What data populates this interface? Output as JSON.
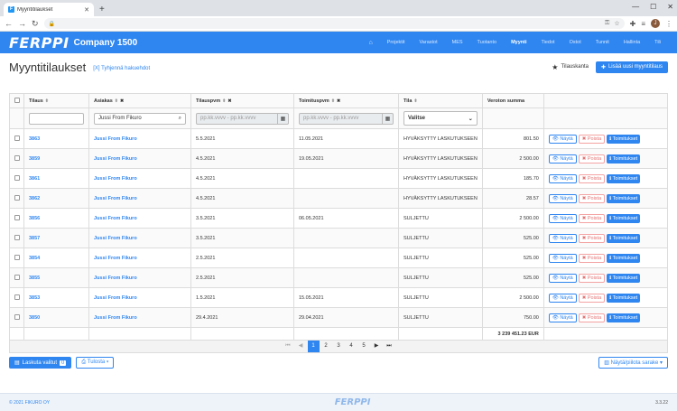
{
  "browser": {
    "tab_title": "Myyntitilaukset",
    "favicon": "F",
    "new_tab": "+",
    "profile_initial": "J"
  },
  "app": {
    "logo": "FERPPI",
    "company": "Company 1500",
    "nav": [
      "Projektit",
      "Varastot",
      "MES",
      "Tuotanto",
      "Myynti",
      "Tiedot",
      "Ostot",
      "Tunnit",
      "Hallinta",
      "Tili"
    ],
    "active_nav": "Myynti"
  },
  "page": {
    "title": "Myyntitilaukset",
    "clear_filters": "[X] Tyhjennä hakuehdot",
    "favorite_label": "Tilauskanta",
    "add_button": "Lisää uusi myyntitilaus"
  },
  "table": {
    "headers": [
      "Tilaus",
      "Asiakas",
      "Tilauspvm",
      "Toimituspvm",
      "Tila",
      "Veroton summa"
    ],
    "filters": {
      "customer": "Jussi From Fikuro",
      "date_placeholder": "pp.kk.vvvv - pp.kk.vvvv",
      "status_select": "Valitse"
    },
    "actions": {
      "view": "Näytä",
      "delete": "Poista",
      "deliveries": "Toimitukset"
    },
    "rows": [
      {
        "id": "3863",
        "customer": "Jussi From Fikuro",
        "order_date": "5.5.2021",
        "delivery_date": "11.05.2021",
        "status": "HYVÄKSYTTY LASKUTUKSEEN",
        "amount": "801.50"
      },
      {
        "id": "3859",
        "customer": "Jussi From Fikuro",
        "order_date": "4.5.2021",
        "delivery_date": "19.05.2021",
        "status": "HYVÄKSYTTY LASKUTUKSEEN",
        "amount": "2 500.00"
      },
      {
        "id": "3861",
        "customer": "Jussi From Fikuro",
        "order_date": "4.5.2021",
        "delivery_date": "",
        "status": "HYVÄKSYTTY LASKUTUKSEEN",
        "amount": "185.70"
      },
      {
        "id": "3862",
        "customer": "Jussi From Fikuro",
        "order_date": "4.5.2021",
        "delivery_date": "",
        "status": "HYVÄKSYTTY LASKUTUKSEEN",
        "amount": "28.57"
      },
      {
        "id": "3856",
        "customer": "Jussi From Fikuro",
        "order_date": "3.5.2021",
        "delivery_date": "06.05.2021",
        "status": "SULJETTU",
        "amount": "2 500.00"
      },
      {
        "id": "3857",
        "customer": "Jussi From Fikuro",
        "order_date": "3.5.2021",
        "delivery_date": "",
        "status": "SULJETTU",
        "amount": "525.00"
      },
      {
        "id": "3854",
        "customer": "Jussi From Fikuro",
        "order_date": "2.5.2021",
        "delivery_date": "",
        "status": "SULJETTU",
        "amount": "525.00"
      },
      {
        "id": "3855",
        "customer": "Jussi From Fikuro",
        "order_date": "2.5.2021",
        "delivery_date": "",
        "status": "SULJETTU",
        "amount": "525.00"
      },
      {
        "id": "3853",
        "customer": "Jussi From Fikuro",
        "order_date": "1.5.2021",
        "delivery_date": "15.05.2021",
        "status": "SULJETTU",
        "amount": "2 500.00"
      },
      {
        "id": "3850",
        "customer": "Jussi From Fikuro",
        "order_date": "29.4.2021",
        "delivery_date": "29.04.2021",
        "status": "SULJETTU",
        "amount": "750.00"
      }
    ],
    "total": "3 239 451.23 EUR"
  },
  "pagination": {
    "pages": [
      "1",
      "2",
      "3",
      "4",
      "5"
    ],
    "current": "1"
  },
  "bottom": {
    "invoice_button": "Laskuta valitut",
    "invoice_count": "0",
    "print_button": "Tulosta",
    "columns_button": "Näytä/piilota sarake"
  },
  "footer": {
    "copyright": "© 2021 FIKURO OY",
    "logo": "FERPPI",
    "version": "3.3.22"
  }
}
